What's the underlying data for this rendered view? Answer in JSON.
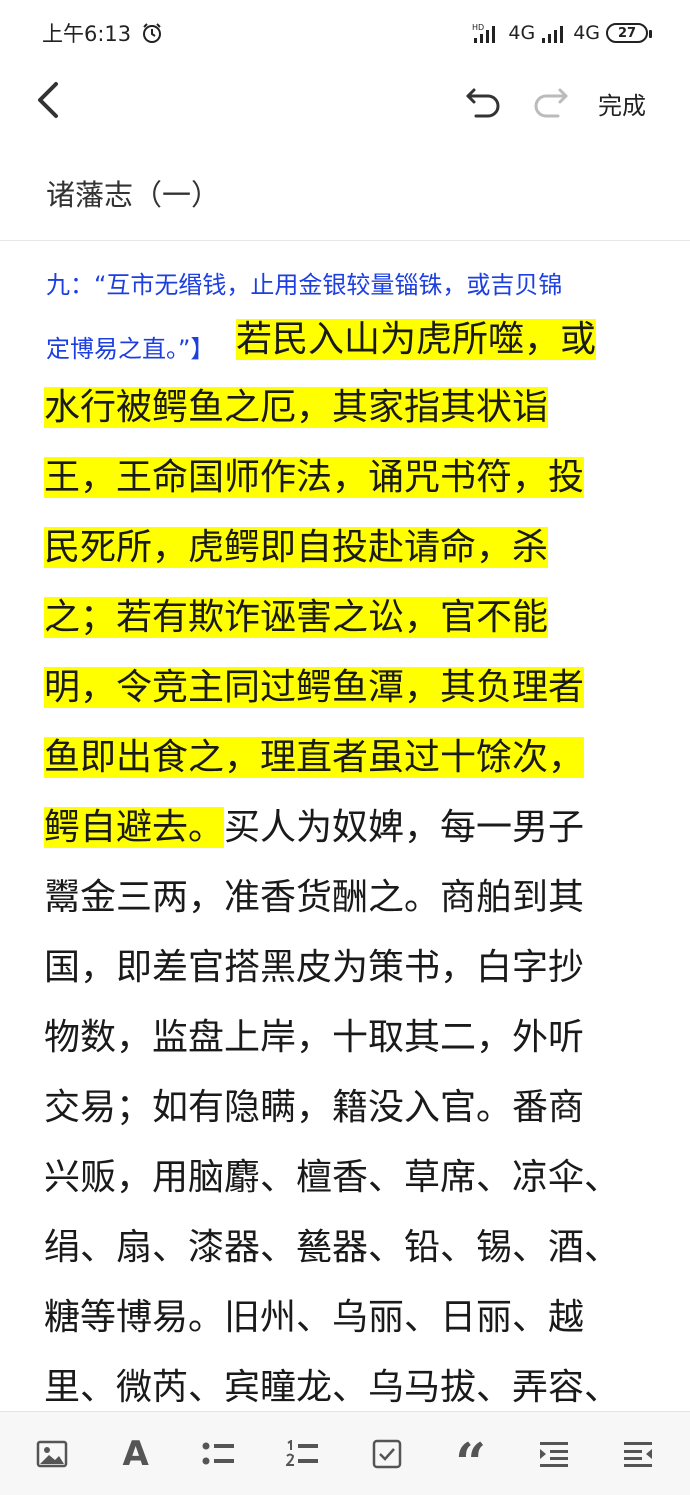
{
  "status_bar": {
    "time": "上午6:13",
    "network_1": "4G",
    "network_2": "4G",
    "hd_label": "HD",
    "battery": "27"
  },
  "toolbar": {
    "done_label": "完成"
  },
  "document": {
    "title": "诸藩志（一）",
    "note_lines": [
      "九：“互市无缗钱，止用金银较量锱铢，或吉贝锦",
      "定博易之直。”】"
    ],
    "line_1_highlight": "若民入山为虎所噬，或",
    "highlighted_lines": [
      "水行被鳄鱼之厄，其家指其状诣",
      "王，王命国师作法，诵咒书符，投",
      "民死所，虎鳄即自投赴请命，杀",
      "之；若有欺诈诬害之讼，官不能",
      "明，令竞主同过鳄鱼潭，其负理者",
      "鱼即出食之，理直者虽过十馀次，"
    ],
    "mixed_line_highlight": "鳄自避去。",
    "mixed_line_plain": "买人为奴婢，每一男子",
    "plain_lines": [
      "鬻金三两，准香货酬之。商舶到其",
      "国，即差官搭黑皮为策书，白字抄",
      "物数，监盘上岸，十取其二，外听",
      "交易；如有隐瞒，籍没入官。番商",
      "兴贩，用脑麝、檀香、草席、凉伞、",
      "绢、扇、漆器、甆器、铅、锡、酒、",
      "糖等博易。旧州、乌丽、日丽、越",
      "里、微芮、宾瞳龙、乌马拔、弄容、"
    ]
  },
  "bottom_toolbar": {
    "font_glyph": "A",
    "quote_glyph": "“",
    "icons": [
      "image-icon",
      "font-icon",
      "bullet-list-icon",
      "numbered-list-icon",
      "checkbox-icon",
      "quote-icon",
      "indent-icon",
      "outdent-icon"
    ]
  },
  "colors": {
    "highlight": "#ffff00",
    "note_text": "#1d3fe0",
    "body_text": "#1a1a1a"
  }
}
